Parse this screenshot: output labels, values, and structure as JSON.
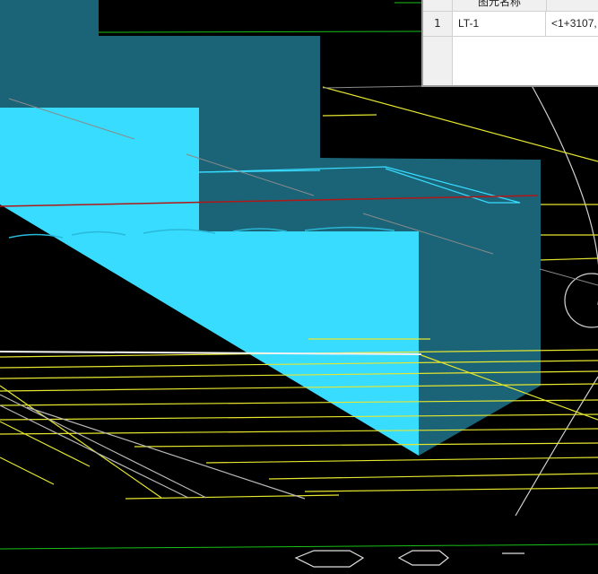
{
  "viewport": {
    "background_color": "#000000",
    "member_color": "#38dcff",
    "member_side_color": "#1b6478",
    "grid_line_color": "#e8e830",
    "axis_line_color": "#c8c8c8"
  },
  "properties_panel": {
    "column_header": "图元名称",
    "rows": [
      {
        "index": "1",
        "name": "LT-1",
        "position": "<1+3107,"
      }
    ]
  }
}
